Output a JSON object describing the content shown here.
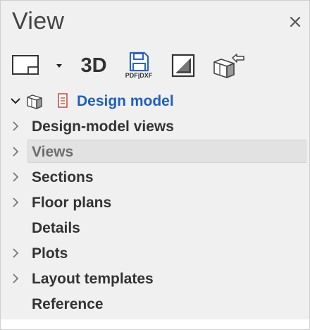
{
  "panel": {
    "title": "View",
    "close_icon": "close-icon"
  },
  "toolbar": {
    "buttons": [
      {
        "name": "view-frame-button",
        "icon": "view-frame-icon"
      },
      {
        "name": "view-frame-dropdown",
        "icon": "caret-down-icon"
      },
      {
        "name": "3d-button",
        "label": "3D"
      },
      {
        "name": "save-pdf-dxf-button",
        "icon": "save-disk-icon",
        "label": "PDF|DXF"
      },
      {
        "name": "section-view-button",
        "icon": "half-shaded-square-icon"
      },
      {
        "name": "insert-model-button",
        "icon": "model-insert-arrow-icon"
      }
    ]
  },
  "tree": {
    "root": {
      "label": "Design model",
      "expanded": true,
      "accent": "#1f5fbd"
    },
    "items": [
      {
        "label": "Design-model views",
        "has_children": true,
        "selected": false
      },
      {
        "label": "Views",
        "has_children": true,
        "selected": true
      },
      {
        "label": "Sections",
        "has_children": true,
        "selected": false
      },
      {
        "label": "Floor plans",
        "has_children": true,
        "selected": false
      },
      {
        "label": "Details",
        "has_children": false,
        "selected": false
      },
      {
        "label": "Plots",
        "has_children": true,
        "selected": false
      },
      {
        "label": "Layout templates",
        "has_children": true,
        "selected": false
      },
      {
        "label": "Reference",
        "has_children": false,
        "selected": false
      }
    ]
  }
}
